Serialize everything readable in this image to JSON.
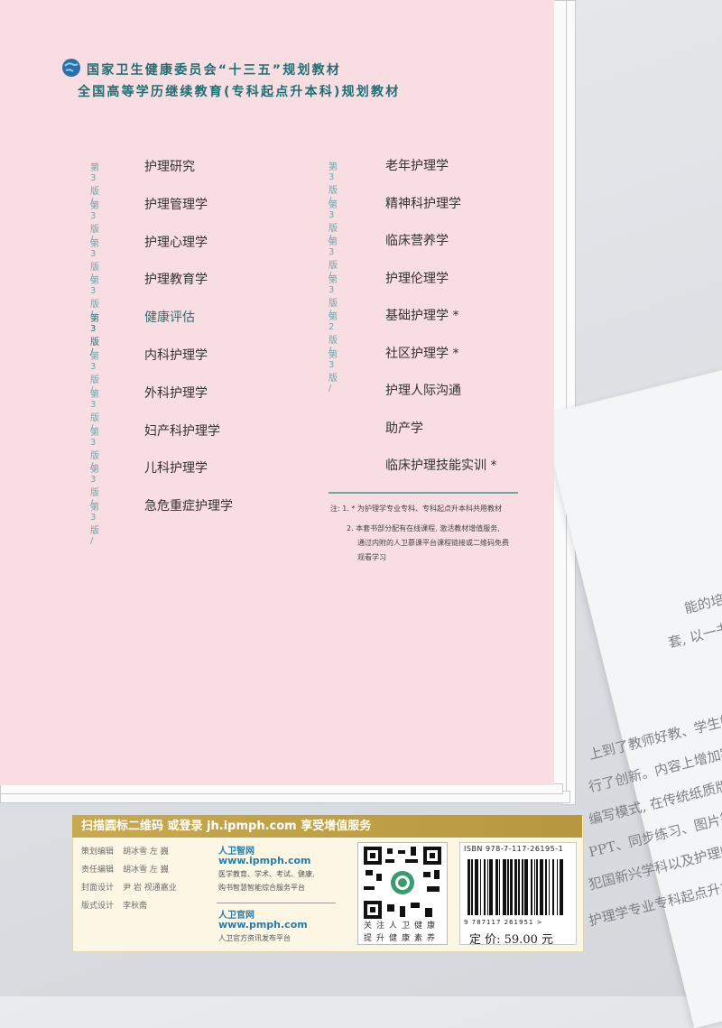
{
  "header": {
    "line1": "国家卫生健康委员会“十三五”规划教材",
    "line2": "全国高等学历继续教育(专科起点升本科)规划教材"
  },
  "books_left": [
    {
      "edition": "第 3 版 /",
      "title": "护理研究"
    },
    {
      "edition": "第 3 版 /",
      "title": "护理管理学"
    },
    {
      "edition": "第 3 版 /",
      "title": "护理心理学"
    },
    {
      "edition": "第 3 版 /",
      "title": "护理教育学"
    },
    {
      "edition": "第 3 版 /",
      "title": "健康评估"
    },
    {
      "edition": "第 3 版 /",
      "title": "内科护理学"
    },
    {
      "edition": "第 3 版 /",
      "title": "外科护理学"
    },
    {
      "edition": "第 3 版 /",
      "title": "妇产科护理学"
    },
    {
      "edition": "第 3 版 /",
      "title": "儿科护理学"
    },
    {
      "edition": "第 3 版 /",
      "title": "急危重症护理学"
    }
  ],
  "books_right": [
    {
      "edition": "第 3 版 /",
      "title": "老年护理学"
    },
    {
      "edition": "第 3 版 /",
      "title": "精神科护理学"
    },
    {
      "edition": "第 3 版 /",
      "title": "临床营养学"
    },
    {
      "edition": "第 3 版 /",
      "title": "护理伦理学"
    },
    {
      "edition": "第 2 版 /",
      "title": "基础护理学 *"
    },
    {
      "edition": "第 3 版 /",
      "title": "社区护理学 *"
    },
    {
      "edition": "",
      "title": "护理人际沟通"
    },
    {
      "edition": "",
      "title": "助产学"
    },
    {
      "edition": "",
      "title": "临床护理技能实训 *"
    }
  ],
  "notes": {
    "n1": "注: 1. * 为护理学专业专科、专科起点升本科共用教材",
    "n2a": "2. 本套书部分配有在线课程, 激活教材增值服务,",
    "n2b": "通过内附的人卫慕课平台课程链接或二维码免费",
    "n2c": "观看学习"
  },
  "bottom": {
    "scan_banner": "扫描圆标二维码 或登录 jh.ipmph.com 享受增值服务",
    "credits": [
      {
        "role": "策划编辑",
        "name": "胡冰雪  左  巍"
      },
      {
        "role": "责任编辑",
        "name": "胡冰雪  左  巍"
      },
      {
        "role": "封面设计",
        "name": "尹  岩  视通嘉业"
      },
      {
        "role": "版式设计",
        "name": "李秋斋"
      }
    ],
    "site1_title": "人卫智网",
    "site1_url": "www.ipmph.com",
    "site1_desc1": "医学教育、学术、考试、健康,",
    "site1_desc2": "购书智慧智能综合服务平台",
    "site2_title": "人卫官网",
    "site2_url": "www.pmph.com",
    "site2_desc": "人卫官方资讯发布平台",
    "qr_caption1": "关注人卫健康",
    "qr_caption2": "提升健康素养",
    "isbn": "ISBN 978-7-117-26195-1",
    "barcode_digits": "9 787117 261951 >",
    "price": "定  价: 59.00 元"
  },
  "background_text": [
    "能的培养",
    "套, 以一书",
    "上到了教师好教、学生好学、",
    "行了创新。内容上增加案例",
    "编写模式, 在传统纸质版教材",
    "PPT、同步练习、图片等。",
    "犯国新兴学科以及护理临床",
    "护理学专业专科起点升本科"
  ],
  "colors": {
    "cover": "#f8dde2",
    "accent": "#2b6e72",
    "gold": "#c9a94f"
  }
}
